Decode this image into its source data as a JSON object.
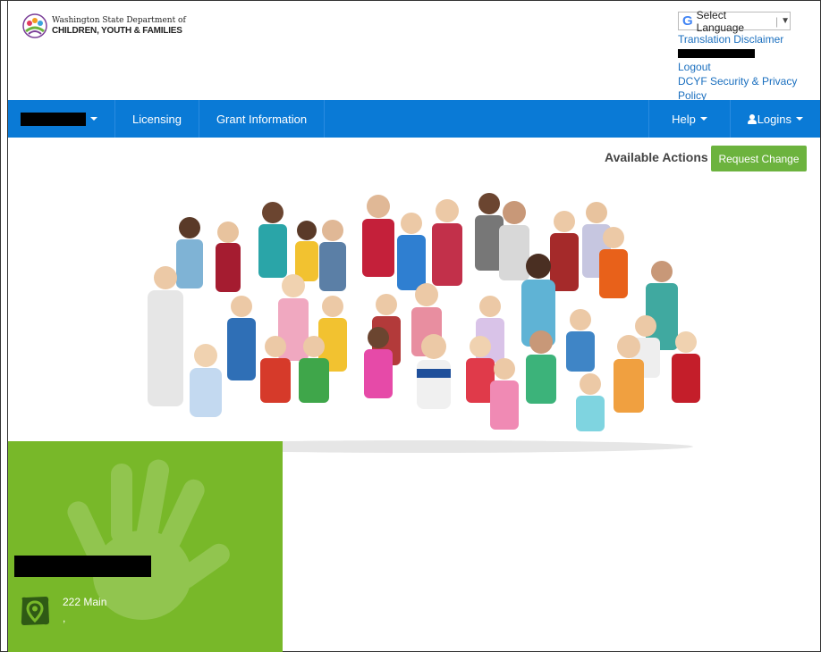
{
  "header": {
    "logo_line1": "Washington State Department of",
    "logo_line2": "CHILDREN, YOUTH & FAMILIES",
    "language_label": "Select Language",
    "language_separator": "|",
    "translation_disclaimer": "Translation Disclaimer",
    "logout": "Logout",
    "security_privacy": "DCYF Security & Privacy Policy"
  },
  "nav": {
    "items": [
      {
        "label": "Licensing"
      },
      {
        "label": "Grant Information"
      }
    ],
    "help": "Help",
    "logins": "Logins"
  },
  "actions": {
    "label": "Available Actions :",
    "request_change": "Request Change"
  },
  "provider": {
    "address_line1": "222 Main",
    "address_line2": ","
  },
  "colors": {
    "nav_blue": "#0a7ad6",
    "accent_green": "#78b829",
    "button_green": "#6cb33e",
    "link_blue": "#1a6fbf"
  },
  "icons": [
    "google-translate-icon",
    "caret-down-icon",
    "user-icon",
    "location-pin-icon",
    "hand-print-icon"
  ]
}
